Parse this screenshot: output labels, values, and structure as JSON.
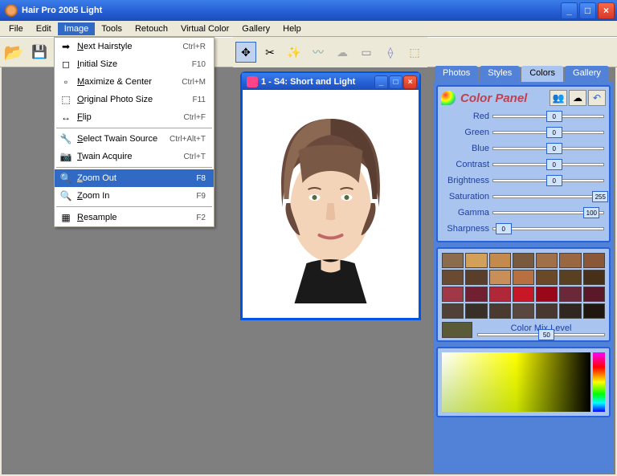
{
  "title": "Hair Pro 2005  Light",
  "menubar": [
    "File",
    "Edit",
    "Image",
    "Tools",
    "Retouch",
    "Virtual Color",
    "Gallery",
    "Help"
  ],
  "menubar_open_index": 2,
  "dropdown": [
    {
      "icon": "➡",
      "label": "Next Hairstyle",
      "shortcut": "Ctrl+R"
    },
    {
      "icon": "◻",
      "label": "Initial Size",
      "shortcut": "F10"
    },
    {
      "icon": "▫",
      "label": "Maximize & Center",
      "shortcut": "Ctrl+M"
    },
    {
      "icon": "⬚",
      "label": "Original Photo Size",
      "shortcut": "F11"
    },
    {
      "icon": "↔",
      "label": "Flip",
      "shortcut": "Ctrl+F"
    },
    {
      "sep": true
    },
    {
      "icon": "🔧",
      "label": "Select Twain Source",
      "shortcut": "Ctrl+Alt+T"
    },
    {
      "icon": "📷",
      "label": "Twain Acquire",
      "shortcut": "Ctrl+T"
    },
    {
      "sep": true
    },
    {
      "icon": "🔍",
      "label": "Zoom Out",
      "shortcut": "F8",
      "hover": true
    },
    {
      "icon": "🔍",
      "label": "Zoom In",
      "shortcut": "F9"
    },
    {
      "sep": true
    },
    {
      "icon": "▦",
      "label": "Resample",
      "shortcut": "F2"
    }
  ],
  "child_window": {
    "title": "1 - S4: Short and Light"
  },
  "right_panel": {
    "tabs": [
      "Photos",
      "Styles",
      "Colors",
      "Gallery"
    ],
    "active_tab": 2,
    "title": "Color Panel",
    "sliders": [
      {
        "name": "Red",
        "value": 0,
        "pos": 48
      },
      {
        "name": "Green",
        "value": 0,
        "pos": 48
      },
      {
        "name": "Blue",
        "value": 0,
        "pos": 48
      },
      {
        "name": "Contrast",
        "value": 0,
        "pos": 48
      },
      {
        "name": "Brightness",
        "value": 0,
        "pos": 48
      },
      {
        "name": "Saturation",
        "value": 255,
        "pos": 90
      },
      {
        "name": "Gamma",
        "value": 100,
        "pos": 82
      },
      {
        "name": "Sharpness",
        "value": 0,
        "pos": 2
      }
    ],
    "swatches": [
      "#8b6d4e",
      "#d2a05a",
      "#c4894c",
      "#7a5a3e",
      "#a07048",
      "#9a6840",
      "#8a5838",
      "#6b4a32",
      "#5a3e2a",
      "#c89058",
      "#b87040",
      "#6a4828",
      "#584020",
      "#483018",
      "#a03848",
      "#702030",
      "#b02838",
      "#c81828",
      "#980818",
      "#6a2838",
      "#5a1828",
      "#504038",
      "#383028",
      "#4a3a30",
      "#5a4840",
      "#483830",
      "#302820",
      "#201810"
    ],
    "mix_label": "Color Mix Level",
    "mix_value": 50
  }
}
